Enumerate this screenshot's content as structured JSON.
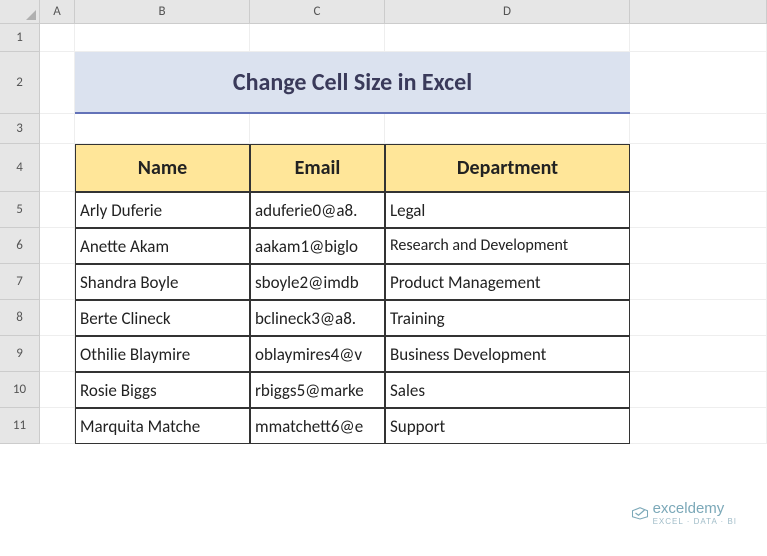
{
  "columns": {
    "A": "A",
    "B": "B",
    "C": "C",
    "D": "D"
  },
  "rows": [
    "1",
    "2",
    "3",
    "4",
    "5",
    "6",
    "7",
    "8",
    "9",
    "10",
    "11"
  ],
  "title": "Change Cell Size in Excel",
  "headers": {
    "name": "Name",
    "email": "Email",
    "dept": "Department"
  },
  "data": [
    {
      "name": "Arly Duferie",
      "email": "aduferie0@a8.",
      "dept": "Legal"
    },
    {
      "name": "Anette Akam",
      "email": "aakam1@biglo",
      "dept": "Research and Development"
    },
    {
      "name": "Shandra Boyle",
      "email": "sboyle2@imdb",
      "dept": "Product Management"
    },
    {
      "name": "Berte Clineck",
      "email": "bclineck3@a8.",
      "dept": "Training"
    },
    {
      "name": "Othilie Blaymire",
      "email": "oblaymires4@v",
      "dept": "Business Development"
    },
    {
      "name": "Rosie Biggs",
      "email": "rbiggs5@marke",
      "dept": "Sales"
    },
    {
      "name": "Marquita Matche",
      "email": "mmatchett6@e",
      "dept": "Support"
    }
  ],
  "watermark": {
    "brand": "exceldemy",
    "tag": "EXCEL · DATA · BI"
  }
}
